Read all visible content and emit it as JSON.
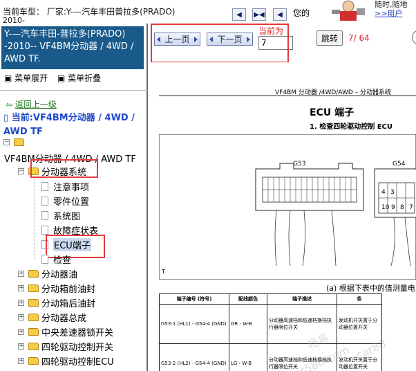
{
  "header": {
    "vehicle_label": "当前车型： 厂家:Y-—汽车丰田普拉多(PRADO)",
    "vehicle_year": "2010-",
    "nav_first_icon": "nav-first-icon",
    "nav_expand_icon": "nav-expand-icon",
    "nav_next_icon": "nav-next-icon",
    "your_text": "您的",
    "top_right_line1": "随时,随地",
    "top_right_link": ">>用户"
  },
  "sidebar": {
    "model_title": "Y-—汽车丰田-普拉多(PRADO) -2010-- VF4BM分动器 / 4WD / AWD TF.",
    "expand_all": "菜单展开",
    "collapse_all": "菜单折叠",
    "back_link": "返回上一级",
    "current_location": "当前:VF4BM分动器 / 4WD / AWD TF",
    "tree_root": "VF4BM分动器 / 4WD / AWD TF",
    "tree": {
      "transfer_system": "分动器系统",
      "items": [
        "注意事项",
        "零件位置",
        "系统图",
        "故障症状表",
        "ECU端子",
        "检查"
      ],
      "folders": [
        "分动器油",
        "分动箱前油封",
        "分动箱后油封",
        "分动器总成",
        "中央差速器锁开关",
        "四轮驱动控制开关",
        "四轮驱动控制ECU"
      ]
    }
  },
  "toolbar": {
    "prev_label": "上一页",
    "next_label": "下一页",
    "current_label": "当前为",
    "page_value": "7",
    "jump_label": "跳转",
    "page_count": "7/ 64"
  },
  "document": {
    "header": "VF4BM 分动器 /4WD/AWD – 分动器系统",
    "title": "ECU 端子",
    "subtitle": "1.    检查四轮驱动控制 ECU",
    "connector_g53": "G53",
    "connector_g54": "G54",
    "diagram_label": "T",
    "table_caption": "(a)   根据下表中的值测量电",
    "table": {
      "headers": [
        "端子编号 (符号)",
        "配线颜色",
        "端子描述",
        "条"
      ],
      "rows": [
        [
          "G53-1 (HL1) - G54-4 (GND)",
          "GR - W-B",
          "分动器高速档和低速档换档执行器限位开关",
          "发动机开关置于分动器位置开关"
        ],
        [
          "G53-2 (HL2) - G54-4 (GND)",
          "LG - W-B",
          "分动器高速档和低速档换档执行器限位开关",
          "发动机开关置于分动器位置开关"
        ]
      ]
    },
    "watermark1": "畅易",
    "watermark2": "car588.com",
    "watermark3": "car88"
  },
  "colors": {
    "model_box_bg": "#1a5a8a",
    "current_location_text": "#2048c8",
    "back_link_text": "#207a20",
    "highlight_red": "#e43a3a",
    "page_count_text": "#e02020"
  }
}
